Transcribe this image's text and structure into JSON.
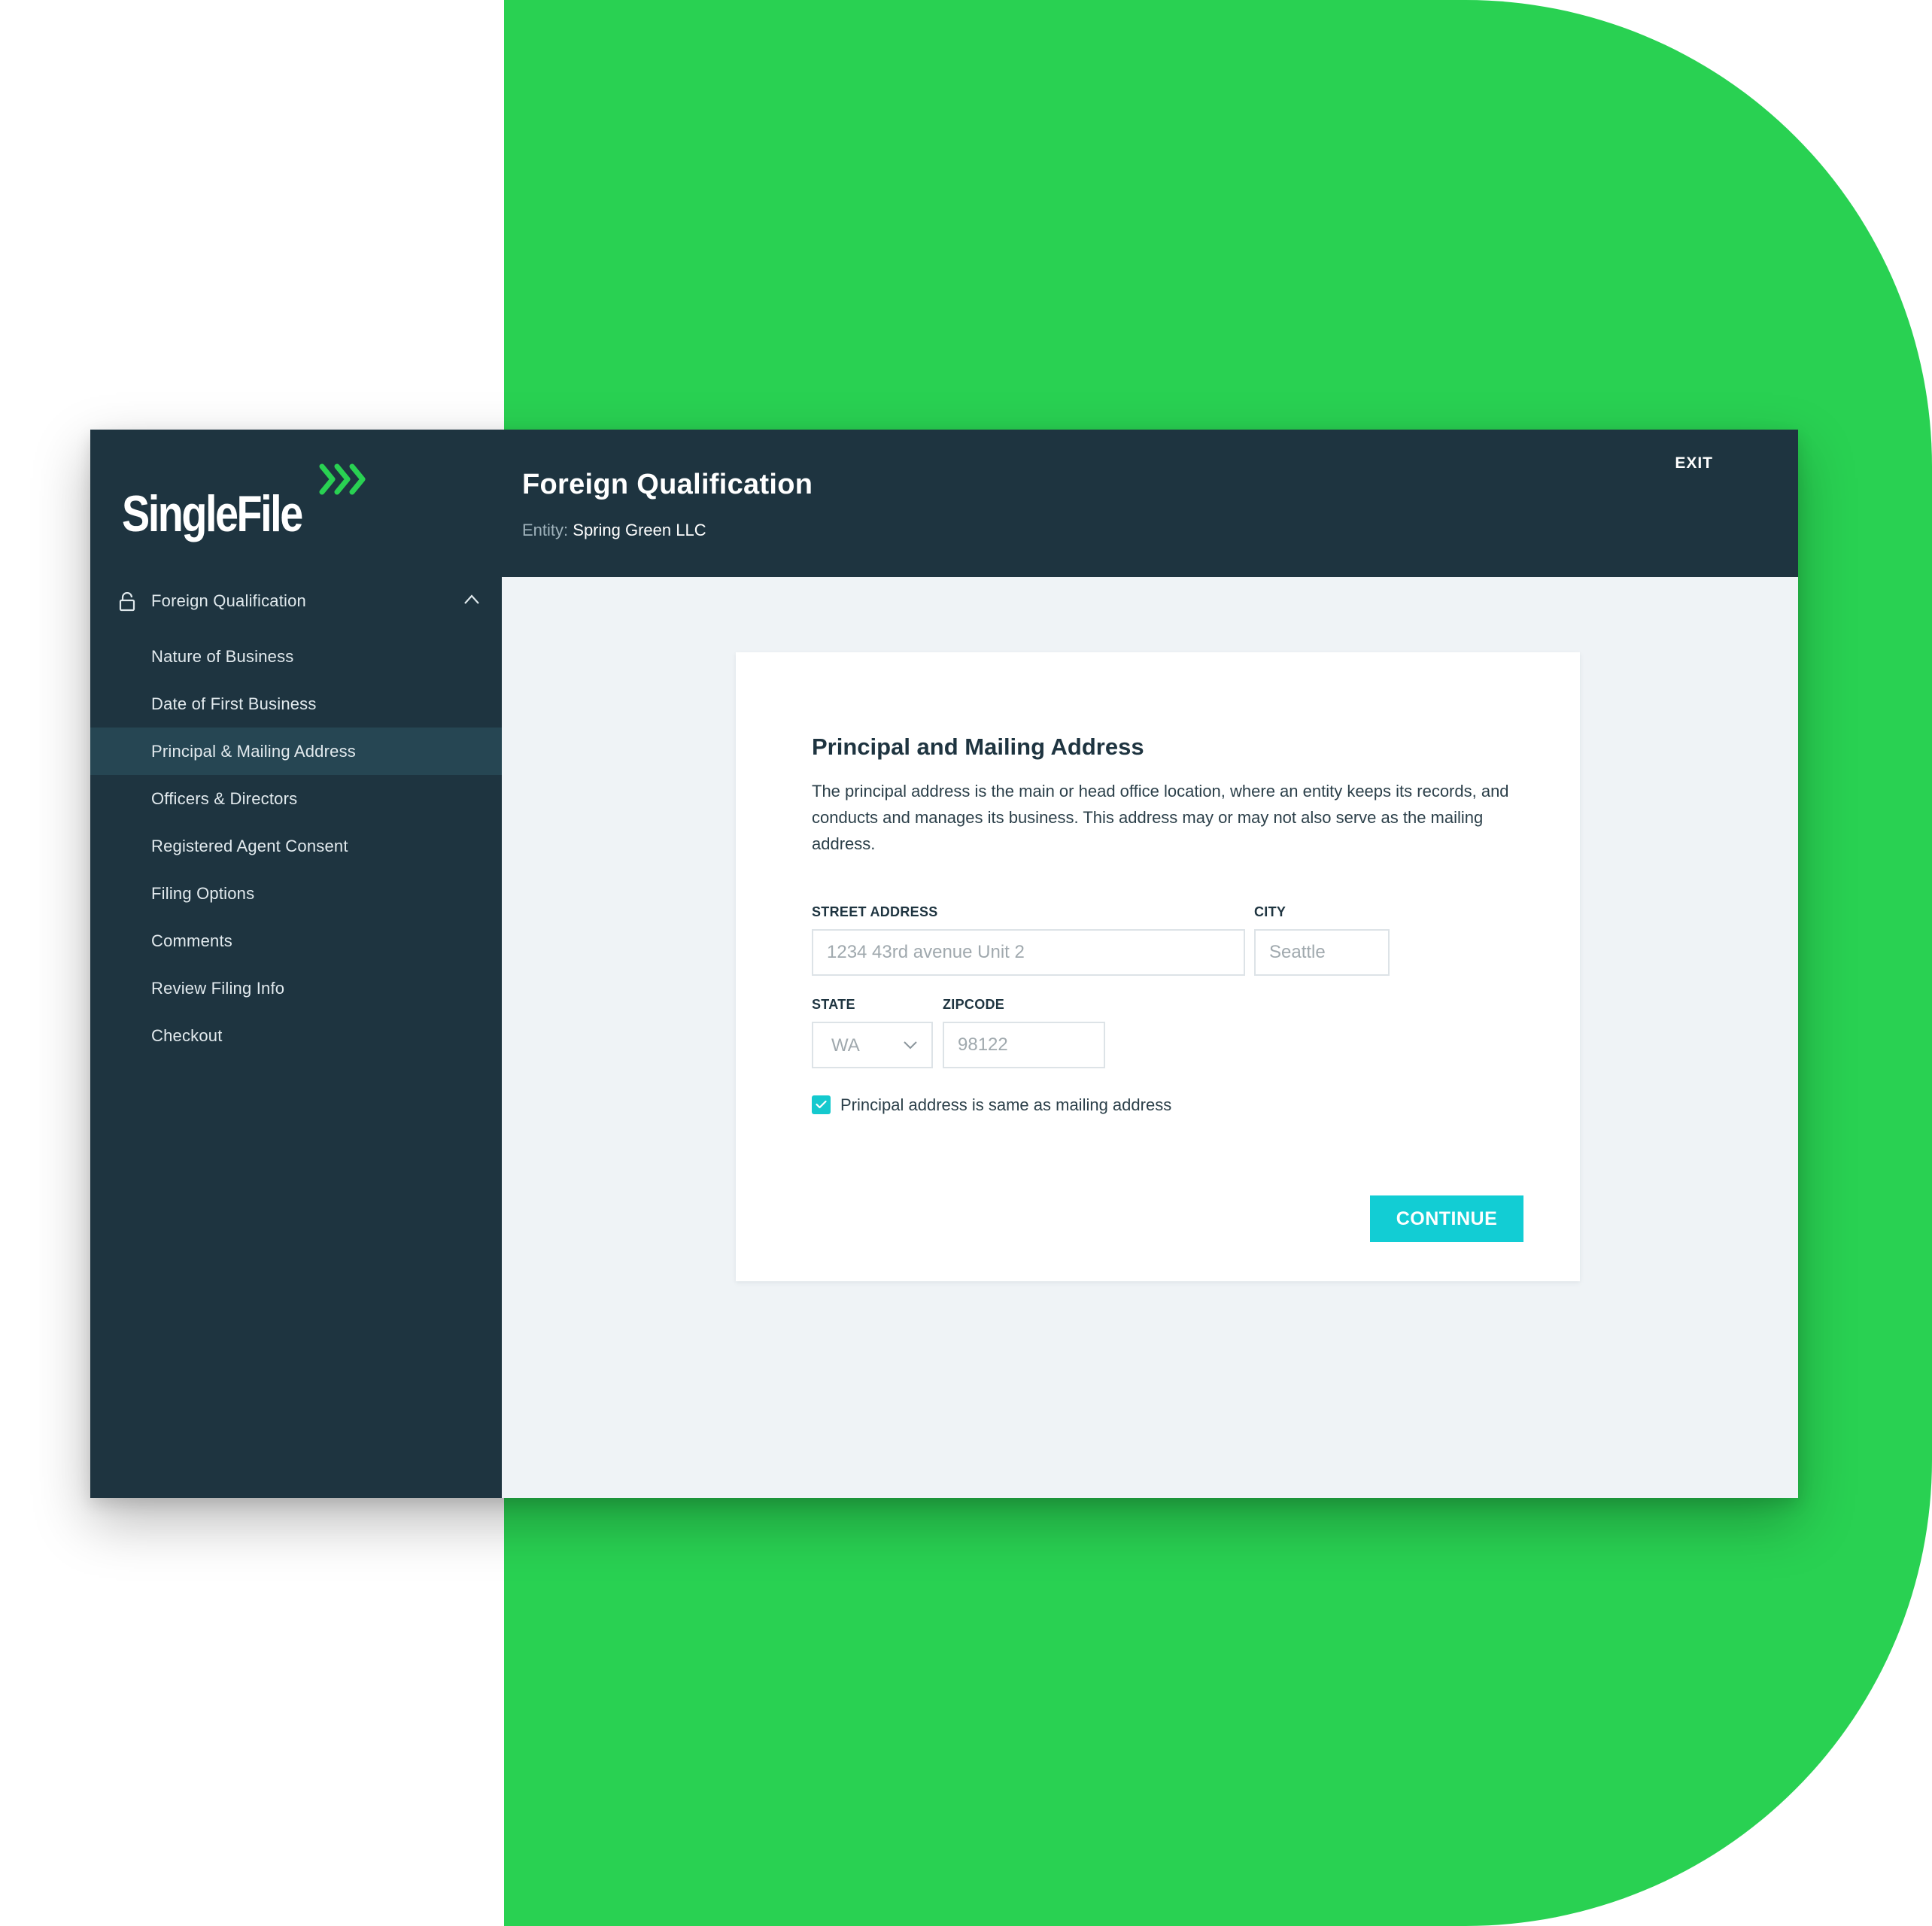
{
  "brand": {
    "name": "SingleFile",
    "accent_color": "#29d152",
    "arrow_icon": "triple-chevron-right-icon"
  },
  "colors": {
    "sidebar_bg": "#1e3440",
    "sidebar_active_bg": "#264653",
    "content_bg": "#eff3f6",
    "button_bg": "#12cdd4",
    "checkbox_bg": "#14c9ce"
  },
  "header": {
    "title": "Foreign Qualification",
    "entity_label": "Entity:",
    "entity_name": "Spring Green LLC",
    "exit_label": "EXIT"
  },
  "sidebar": {
    "section": {
      "label": "Foreign Qualification",
      "icon": "lock-icon",
      "toggle_icon": "chevron-up-icon",
      "expanded": true
    },
    "items": [
      {
        "label": "Nature of Business",
        "active": false
      },
      {
        "label": "Date of First Business",
        "active": false
      },
      {
        "label": "Principal & Mailing Address",
        "active": true
      },
      {
        "label": "Officers & Directors",
        "active": false
      },
      {
        "label": "Registered Agent Consent",
        "active": false
      },
      {
        "label": "Filing Options",
        "active": false
      },
      {
        "label": "Comments",
        "active": false
      },
      {
        "label": "Review Filing Info",
        "active": false
      },
      {
        "label": "Checkout",
        "active": false
      }
    ]
  },
  "form": {
    "title": "Principal and Mailing Address",
    "description": "The principal address is the main or head office location, where an entity keeps its records, and conducts and manages its business. This address may or may not also serve as the mailing address.",
    "street": {
      "label": "STREET ADDRESS",
      "placeholder": "1234 43rd avenue Unit 2",
      "value": ""
    },
    "city": {
      "label": "CITY",
      "placeholder": "Seattle",
      "value": ""
    },
    "state": {
      "label": "STATE",
      "value": "WA",
      "icon": "chevron-down-icon"
    },
    "zipcode": {
      "label": "ZIPCODE",
      "placeholder": "98122",
      "value": ""
    },
    "same_address": {
      "label": "Principal address is same as mailing address",
      "checked": true
    },
    "continue_label": "CONTINUE"
  }
}
